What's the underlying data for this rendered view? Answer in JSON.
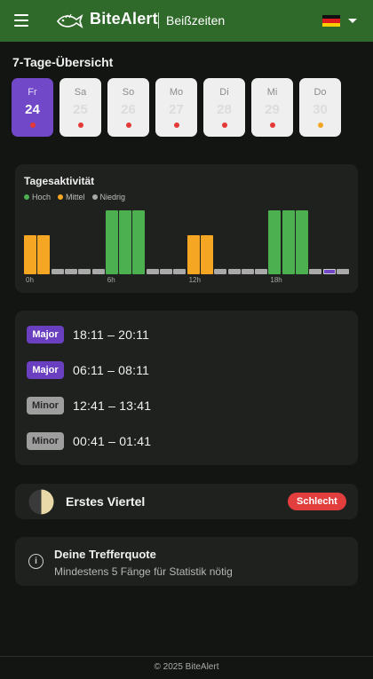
{
  "header": {
    "brand": "BiteAlert",
    "subtitle": "Beißzeiten",
    "language": "de"
  },
  "week": {
    "title": "7-Tage-Übersicht",
    "days": [
      {
        "name": "Fr",
        "num": "24",
        "status": "red",
        "active": true
      },
      {
        "name": "Sa",
        "num": "25",
        "status": "red",
        "active": false
      },
      {
        "name": "So",
        "num": "26",
        "status": "red",
        "active": false
      },
      {
        "name": "Mo",
        "num": "27",
        "status": "red",
        "active": false
      },
      {
        "name": "Di",
        "num": "28",
        "status": "red",
        "active": false
      },
      {
        "name": "Mi",
        "num": "29",
        "status": "red",
        "active": false
      },
      {
        "name": "Do",
        "num": "30",
        "status": "orange",
        "active": false
      }
    ]
  },
  "activity": {
    "title": "Tagesaktivität",
    "legend": [
      {
        "label": "Hoch",
        "color": "#4caf50"
      },
      {
        "label": "Mittel",
        "color": "#f5a623"
      },
      {
        "label": "Niedrig",
        "color": "#a9a9a9"
      }
    ],
    "hours": [
      "0h",
      "6h",
      "12h",
      "18h"
    ],
    "levels": [
      "mittel",
      "mittel",
      "niedrig",
      "niedrig",
      "niedrig",
      "niedrig",
      "hoch",
      "hoch",
      "hoch",
      "niedrig",
      "niedrig",
      "niedrig",
      "mittel",
      "mittel",
      "niedrig",
      "niedrig",
      "niedrig",
      "niedrig",
      "hoch",
      "hoch",
      "hoch",
      "niedrig",
      "jetzt",
      "niedrig"
    ]
  },
  "times": [
    {
      "type": "Major",
      "range": "18:11 – 20:11"
    },
    {
      "type": "Major",
      "range": "06:11 – 08:11"
    },
    {
      "type": "Minor",
      "range": "12:41 – 13:41"
    },
    {
      "type": "Minor",
      "range": "00:41 – 01:41"
    }
  ],
  "moon": {
    "phase": "Erstes Viertel",
    "rating": "Schlecht"
  },
  "hitrate": {
    "title": "Deine Trefferquote",
    "subtitle": "Mindestens 5 Fänge für Statistik nötig"
  },
  "footer": "© 2025 BiteAlert",
  "colors": {
    "header": "#2f6a2b",
    "accent": "#7048c8",
    "hoch": "#4caf50",
    "mittel": "#f5a623",
    "niedrig": "#a9a9a9",
    "bad": "#e23e3e"
  }
}
